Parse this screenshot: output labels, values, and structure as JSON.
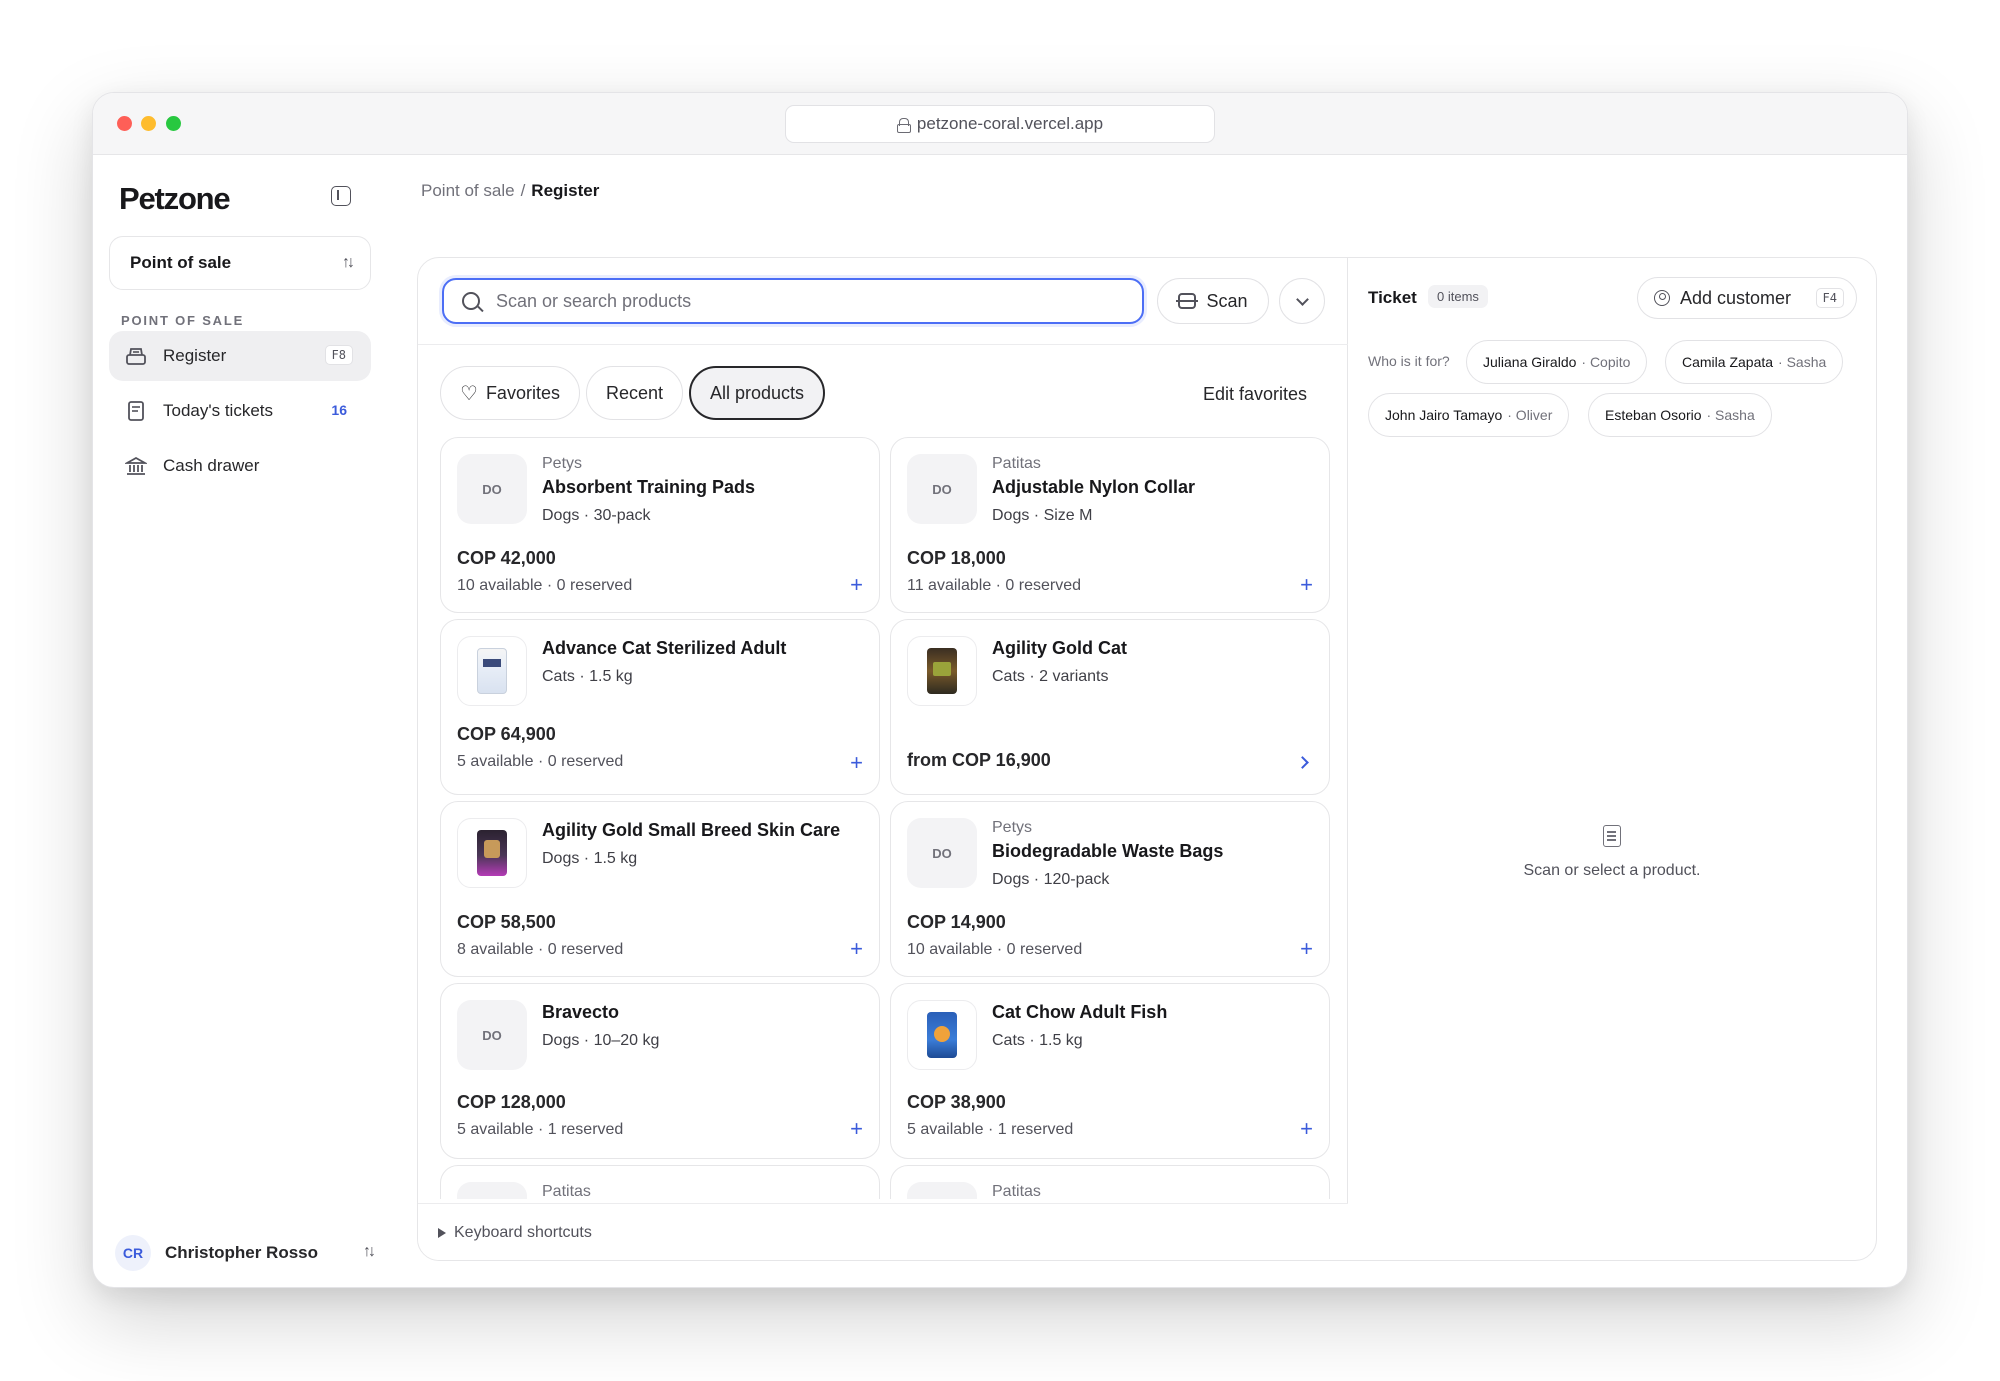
{
  "browser": {
    "url": "petzone-coral.vercel.app"
  },
  "sidebar": {
    "logo": "Petzone",
    "context": "Point of sale",
    "section_label": "POINT OF SALE",
    "items": [
      {
        "label": "Register",
        "shortcut": "F8"
      },
      {
        "label": "Today's tickets",
        "count": "16"
      },
      {
        "label": "Cash drawer"
      }
    ],
    "user": {
      "initials": "CR",
      "name": "Christopher Rosso"
    }
  },
  "breadcrumb": {
    "parent": "Point of sale",
    "separator": "/",
    "current": "Register"
  },
  "search": {
    "placeholder": "Scan or search products",
    "value": ""
  },
  "toolbar": {
    "scan_label": "Scan"
  },
  "tabs": {
    "favorites": "Favorites",
    "recent": "Recent",
    "all": "All products",
    "active": "All products",
    "edit_favorites": "Edit favorites"
  },
  "products": [
    {
      "brand": "Petys",
      "name": "Absorbent Training Pads",
      "meta": "Dogs · 30-pack",
      "price": "COP 42,000",
      "stock": "10 available · 0 reserved",
      "thumb": "DO"
    },
    {
      "brand": "Patitas",
      "name": "Adjustable Nylon Collar",
      "meta": "Dogs · Size M",
      "price": "COP 18,000",
      "stock": "11 available · 0 reserved",
      "thumb": "DO"
    },
    {
      "brand": "",
      "name": "Advance Cat Sterilized Adult",
      "meta": "Cats · 1.5 kg",
      "price": "COP 64,900",
      "stock": "5 available · 0 reserved",
      "thumb": ""
    },
    {
      "brand": "",
      "name": "Agility Gold Cat",
      "meta": "Cats · 2 variants",
      "price": "from COP 16,900",
      "stock": "",
      "thumb": ""
    },
    {
      "brand": "",
      "name": "Agility Gold Small Breed Skin Care",
      "meta": "Dogs · 1.5 kg",
      "price": "COP 58,500",
      "stock": "8 available · 0 reserved",
      "thumb": ""
    },
    {
      "brand": "Petys",
      "name": "Biodegradable Waste Bags",
      "meta": "Dogs · 120-pack",
      "price": "COP 14,900",
      "stock": "10 available · 0 reserved",
      "thumb": "DO"
    },
    {
      "brand": "",
      "name": "Bravecto",
      "meta": "Dogs · 10–20 kg",
      "price": "COP 128,000",
      "stock": "5 available · 1 reserved",
      "thumb": "DO"
    },
    {
      "brand": "",
      "name": "Cat Chow Adult Fish",
      "meta": "Cats · 1.5 kg",
      "price": "COP 38,900",
      "stock": "5 available · 1 reserved",
      "thumb": ""
    },
    {
      "brand": "Patitas"
    },
    {
      "brand": "Patitas"
    }
  ],
  "footer": {
    "keyboard_shortcuts": "Keyboard shortcuts"
  },
  "ticket": {
    "title": "Ticket",
    "badge": "0 items",
    "add_customer": "Add customer",
    "add_customer_shortcut": "F4",
    "who_label": "Who is it for?",
    "customers": [
      {
        "name": "Juliana Giraldo",
        "pet": "· Copito"
      },
      {
        "name": "Camila Zapata",
        "pet": "· Sasha"
      },
      {
        "name": "John Jairo Tamayo",
        "pet": "· Oliver"
      },
      {
        "name": "Esteban Osorio",
        "pet": "· Sasha"
      }
    ],
    "empty_message": "Scan or select a product."
  },
  "colors": {
    "accent": "#3b5bdb",
    "focus": "#4c6ef5"
  }
}
